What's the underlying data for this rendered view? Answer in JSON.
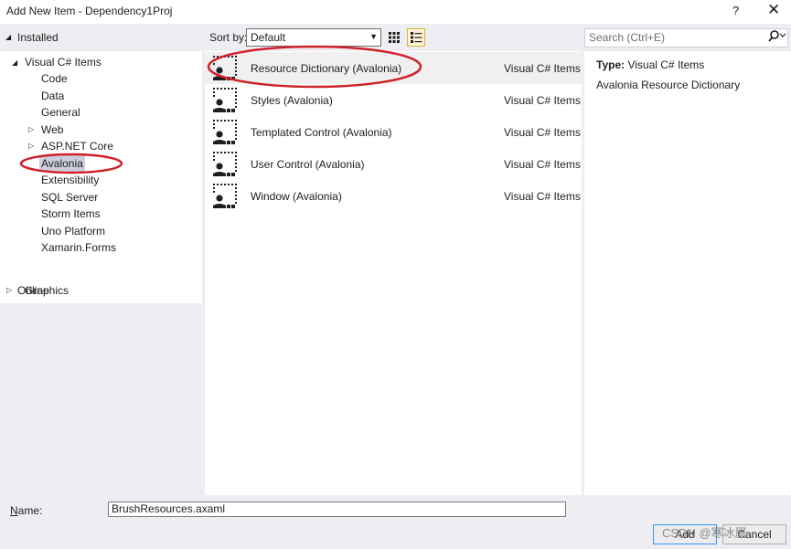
{
  "window": {
    "title": "Add New Item - Dependency1Proj",
    "help": "?",
    "close": "✕"
  },
  "tree": {
    "installed": "Installed",
    "visual_csharp": "Visual C# Items",
    "children": [
      {
        "label": "Code",
        "expandable": false
      },
      {
        "label": "Data",
        "expandable": false
      },
      {
        "label": "General",
        "expandable": false
      },
      {
        "label": "Web",
        "expandable": true
      },
      {
        "label": "ASP.NET Core",
        "expandable": true
      },
      {
        "label": "Avalonia",
        "expandable": false,
        "selected": true
      },
      {
        "label": "Extensibility",
        "expandable": false
      },
      {
        "label": "SQL Server",
        "expandable": false
      },
      {
        "label": "Storm Items",
        "expandable": false
      },
      {
        "label": "Uno Platform",
        "expandable": false
      },
      {
        "label": "Xamarin.Forms",
        "expandable": false
      }
    ],
    "graphics": "Graphics",
    "online": "Online"
  },
  "sort": {
    "label": "Sort by:",
    "value": "Default"
  },
  "templates": [
    {
      "name": "Resource Dictionary (Avalonia)",
      "language": "Visual C# Items",
      "selected": true
    },
    {
      "name": "Styles (Avalonia)",
      "language": "Visual C# Items"
    },
    {
      "name": "Templated Control (Avalonia)",
      "language": "Visual C# Items"
    },
    {
      "name": "User Control (Avalonia)",
      "language": "Visual C# Items"
    },
    {
      "name": "Window (Avalonia)",
      "language": "Visual C# Items"
    }
  ],
  "search": {
    "placeholder": "Search (Ctrl+E)"
  },
  "details": {
    "type_label": "Type:",
    "type_value": "Visual C# Items",
    "description": "Avalonia Resource Dictionary"
  },
  "bottom": {
    "name_label": "Name:",
    "name_value": "BrushResources.axaml",
    "add_label": "Add",
    "cancel_label": "Cancel"
  },
  "watermark": "CSDN @寒冰屋",
  "colors": {
    "annotation": "#d0202a",
    "selection": "#cccedb",
    "accent": "#3399ff"
  }
}
